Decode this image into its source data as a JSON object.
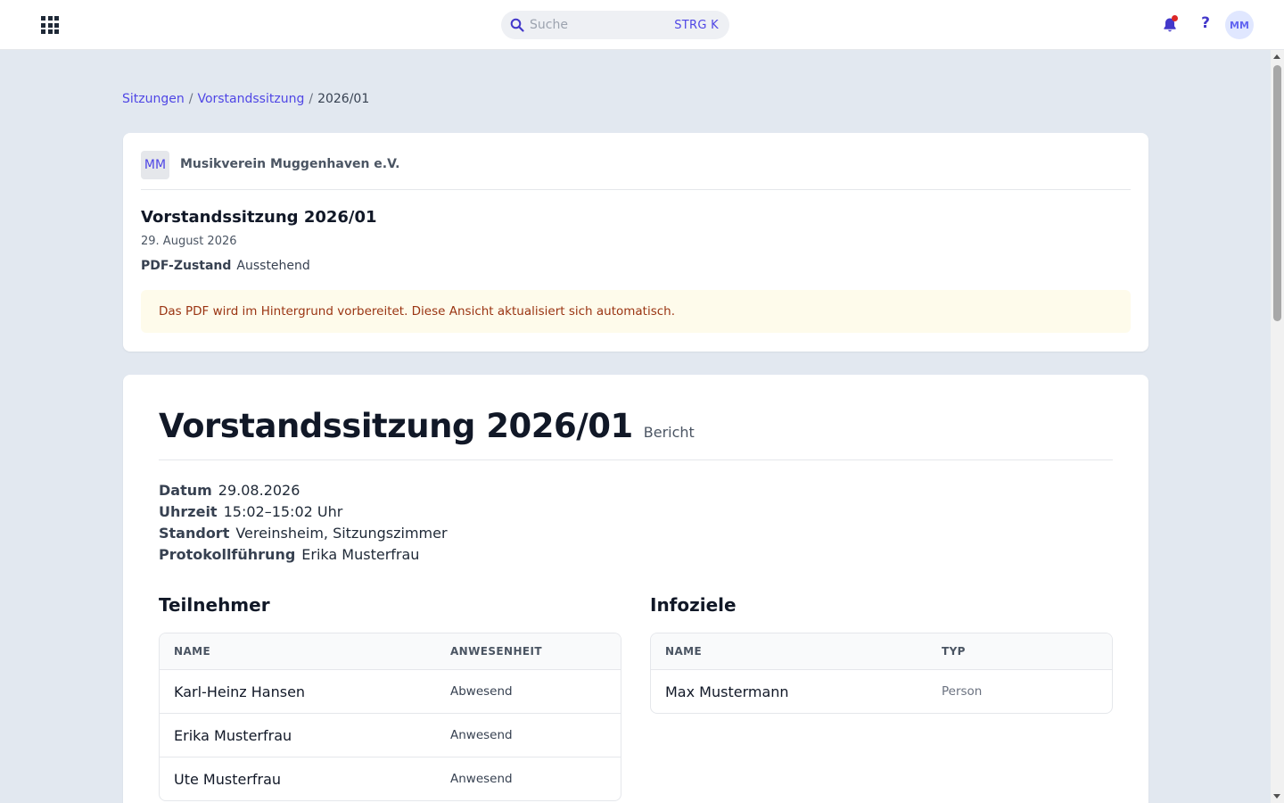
{
  "header": {
    "search_placeholder": "Suche",
    "search_shortcut": "STRG K",
    "help_label": "?",
    "user_initials": "MM"
  },
  "breadcrumb": {
    "items": [
      "Sitzungen",
      "Vorstandssitzung"
    ],
    "current": "2026/01",
    "separator": "/"
  },
  "summary": {
    "org_initials": "MM",
    "org_name": "Musikverein Muggenhaven e.V.",
    "title": "Vorstandssitzung 2026/01",
    "date": "29. August 2026",
    "pdf_state_label": "PDF-Zustand",
    "pdf_state_value": "Ausstehend",
    "notice": "Das PDF wird im Hintergrund vorbereitet. Diese Ansicht aktualisiert sich automatisch."
  },
  "report": {
    "title": "Vorstandssitzung 2026/01",
    "kind": "Bericht",
    "details": [
      {
        "label": "Datum",
        "value": "29.08.2026"
      },
      {
        "label": "Uhrzeit",
        "value": "15:02–15:02 Uhr"
      },
      {
        "label": "Standort",
        "value": "Vereinsheim, Sitzungszimmer"
      },
      {
        "label": "Protokollführung",
        "value": "Erika Musterfrau"
      }
    ],
    "participants": {
      "title": "Teilnehmer",
      "columns": [
        "NAME",
        "ANWESENHEIT"
      ],
      "rows": [
        {
          "name": "Karl-Heinz Hansen",
          "status": "Abwesend"
        },
        {
          "name": "Erika Musterfrau",
          "status": "Anwesend"
        },
        {
          "name": "Ute Musterfrau",
          "status": "Anwesend"
        }
      ]
    },
    "infotargets": {
      "title": "Infoziele",
      "columns": [
        "NAME",
        "TYP"
      ],
      "rows": [
        {
          "name": "Max Mustermann",
          "type": "Person"
        }
      ]
    }
  },
  "colors": {
    "accent": "#4f46e5",
    "background": "#e2e8f0",
    "notice_bg": "#fefbeb",
    "notice_text": "#9a3412",
    "notification_dot": "#dc2626"
  }
}
